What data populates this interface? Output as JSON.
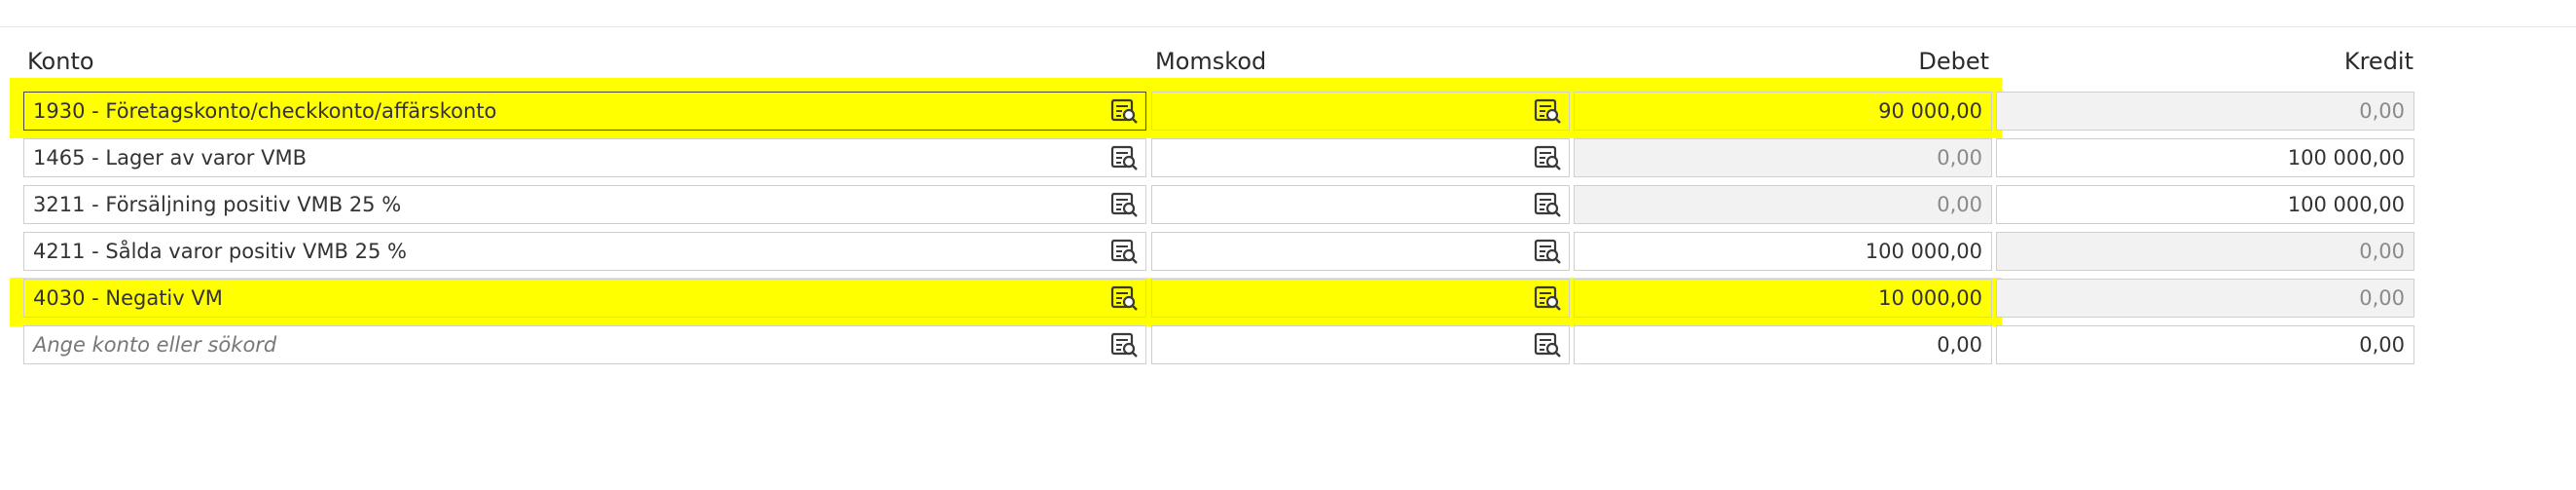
{
  "headers": {
    "konto": "Konto",
    "momskod": "Momskod",
    "debet": "Debet",
    "kredit": "Kredit"
  },
  "search_icon": "list-search-icon",
  "highlight_color": "#ffff00",
  "rows": [
    {
      "konto": "1930 - Företagskonto/checkkonto/affärskonto",
      "momskod": "",
      "debet": "90 000,00",
      "kredit": "0,00",
      "highlighted": true
    },
    {
      "konto": "1465 - Lager av varor VMB",
      "momskod": "",
      "debet": "0,00",
      "kredit": "100 000,00",
      "highlighted": false
    },
    {
      "konto": "3211 - Försäljning positiv VMB 25 %",
      "momskod": "",
      "debet": "0,00",
      "kredit": "100 000,00",
      "highlighted": false
    },
    {
      "konto": "4211 - Sålda varor positiv VMB 25 %",
      "momskod": "",
      "debet": "100 000,00",
      "kredit": "0,00",
      "highlighted": false
    },
    {
      "konto": "4030 - Negativ VM",
      "momskod": "",
      "debet": "10 000,00",
      "kredit": "0,00",
      "highlighted": true
    }
  ],
  "new_row": {
    "konto_placeholder": "Ange konto eller sökord",
    "debet": "0,00",
    "kredit": "0,00"
  }
}
